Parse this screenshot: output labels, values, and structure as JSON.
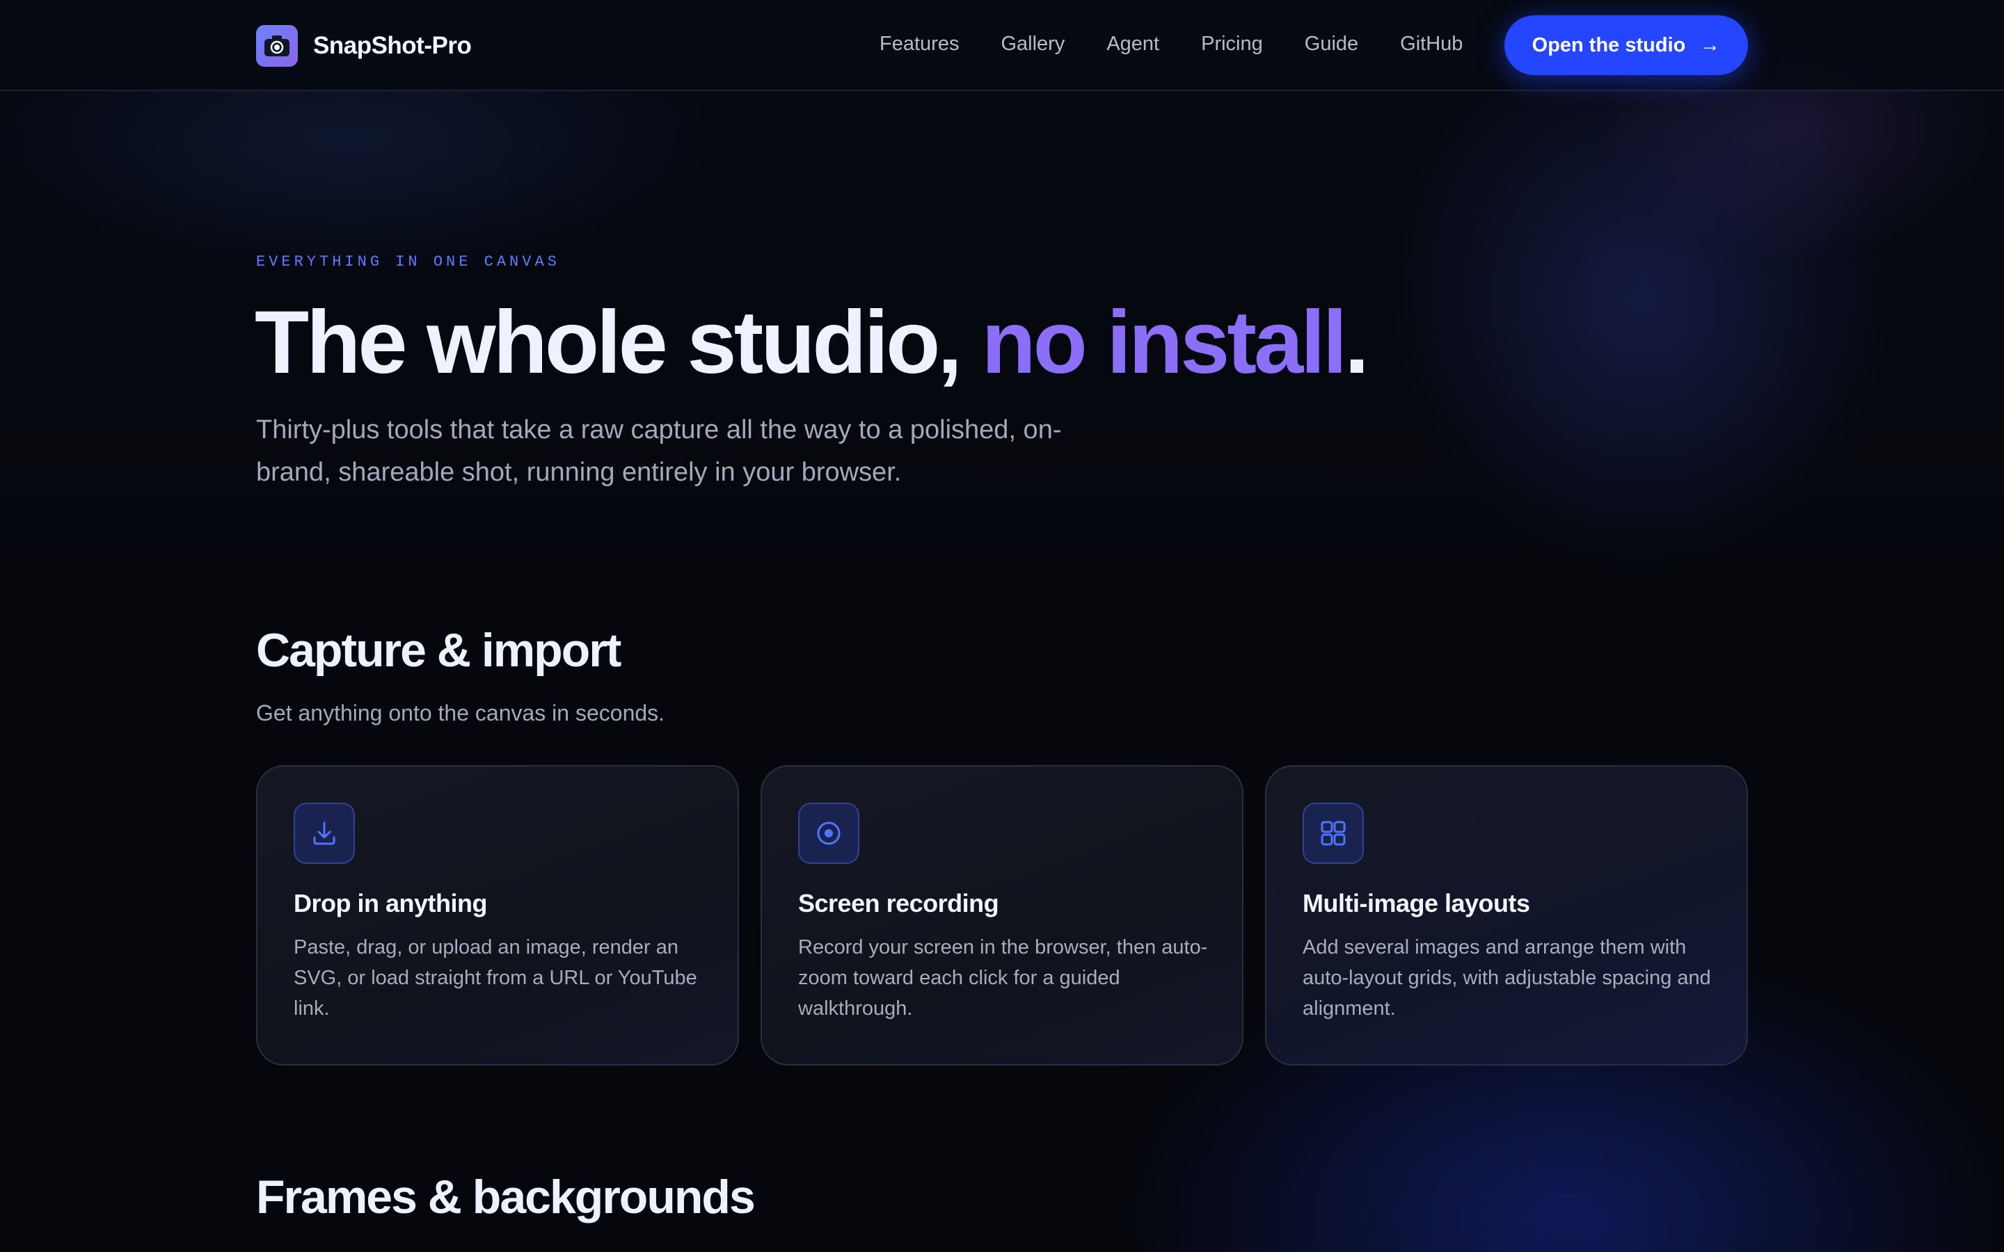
{
  "nav": {
    "brand": "SnapShot-Pro",
    "links": [
      "Features",
      "Gallery",
      "Agent",
      "Pricing",
      "Guide",
      "GitHub"
    ],
    "cta_label": "Open the studio",
    "cta_arrow": "→"
  },
  "hero": {
    "eyebrow": "EVERYTHING IN ONE CANVAS",
    "headline_main": "The whole studio, ",
    "headline_accent": "no install",
    "headline_end": ".",
    "subtitle": "Thirty-plus tools that take a raw capture all the way to a polished, on-brand, shareable shot, running entirely in your browser."
  },
  "sections": [
    {
      "title": "Capture & import",
      "subtitle": "Get anything onto the canvas in seconds.",
      "cards": [
        {
          "icon": "download-icon",
          "title": "Drop in anything",
          "text": "Paste, drag, or upload an image, render an SVG, or load straight from a URL or YouTube link."
        },
        {
          "icon": "record-icon",
          "title": "Screen recording",
          "text": "Record your screen in the browser, then auto-zoom toward each click for a guided walkthrough."
        },
        {
          "icon": "grid-icon",
          "title": "Multi-image layouts",
          "text": "Add several images and arrange them with auto-layout grids, with adjustable spacing and alignment."
        }
      ]
    },
    {
      "title": "Frames & backgrounds"
    }
  ],
  "colors": {
    "background": "#05070d",
    "accent_blue": "#2446ff",
    "accent_purple": "#8b6ff8",
    "eyebrow_blue": "#5b7cff",
    "icon_blue": "#4f74ff"
  }
}
